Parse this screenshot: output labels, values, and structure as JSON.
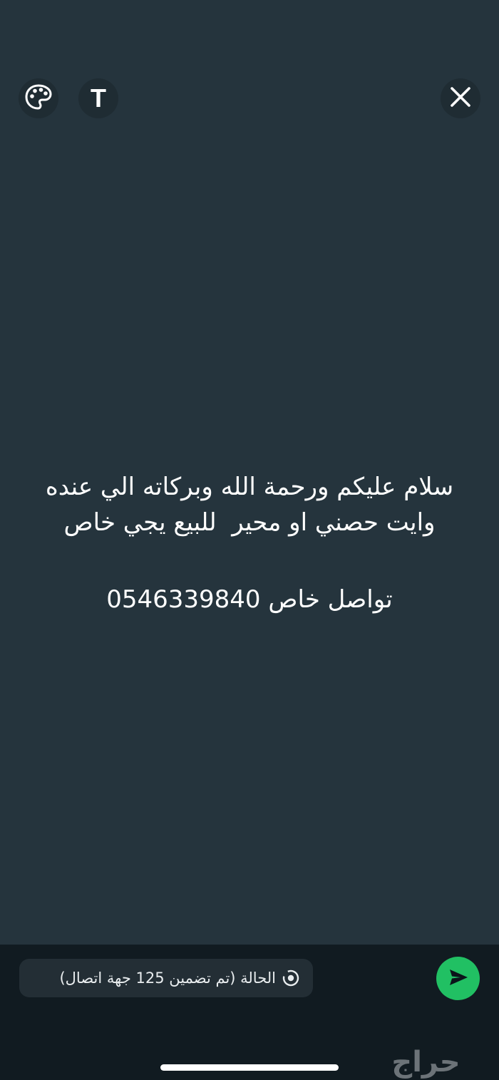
{
  "toolbar": {
    "palette_icon": "palette-icon",
    "text_tool_label": "T",
    "close_icon": "close-icon"
  },
  "status": {
    "lines": [
      "سلام عليكم ورحمة الله وبركاته الي عنده",
      "وايت حصني او محير  للبيع يجي خاص",
      "تواصل خاص 0546339840"
    ],
    "background_color": "#25343d",
    "text_color": "#ffffff"
  },
  "composer": {
    "audience_label": "الحالة (تم تضمين 125 جهة اتصال)",
    "audience_icon": "status-icon",
    "send_icon": "send-icon",
    "send_color": "#21c063"
  },
  "watermark": {
    "text": "حراج"
  }
}
